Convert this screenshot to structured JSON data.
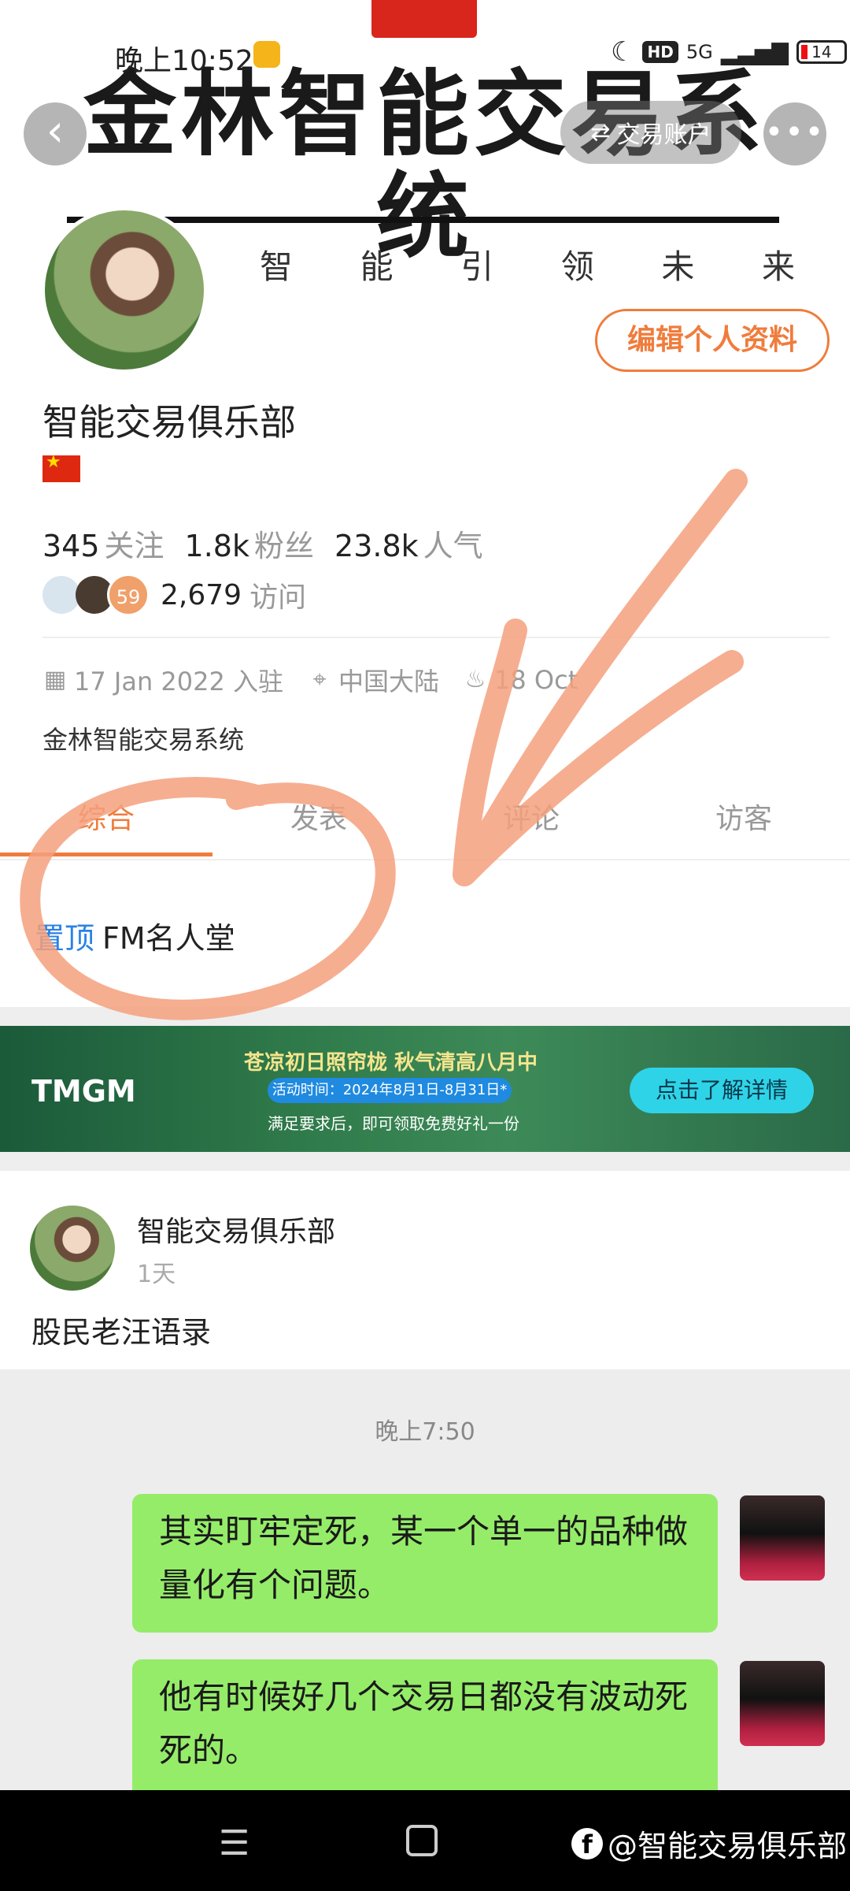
{
  "status_bar": {
    "time": "晚上10:52",
    "network": "5G",
    "hd": "HD",
    "battery": "14"
  },
  "header": {
    "banner_title": "金林智能交易系统",
    "slogan": [
      "智",
      "能",
      "引",
      "领",
      "未",
      "来"
    ]
  },
  "nav": {
    "back_icon": "chevron-left-icon",
    "account_label": "交易账户",
    "account_icon": "swap-icon",
    "more_icon": "more-dots-icon"
  },
  "profile": {
    "edit_label": "编辑个人资料",
    "name": "智能交易俱乐部",
    "flag": "china-flag",
    "stats": {
      "following_count": "345",
      "following_label": "关注",
      "fans_count": "1.8k",
      "fans_label": "粉丝",
      "popularity_count": "23.8k",
      "popularity_label": "人气"
    },
    "visitor_badge": "59",
    "visits_count": "2,679",
    "visits_label": "访问",
    "joined": "17 Jan 2022 入驻",
    "location": "中国大陆",
    "birthday": "18 Oct",
    "bio": "金林智能交易系统"
  },
  "tabs": [
    "综合",
    "发表",
    "评论",
    "访客"
  ],
  "active_tab": "综合",
  "pinned": {
    "tag": "置顶",
    "text": "FM名人堂"
  },
  "ad": {
    "brand": "TMGM",
    "headline": "苍凉初日照帘栊  秋气清高八月中",
    "date": "活动时间：2024年8月1日-8月31日*",
    "sub": "满足要求后，即可领取免费好礼一份",
    "cta": "点击了解详情"
  },
  "post": {
    "author": "智能交易俱乐部",
    "time": "1天",
    "text": "股民老汪语录",
    "chat_time": "晚上7:50",
    "messages": [
      "其实盯牢定死，某一个单一的品种做量化有个问题。",
      "他有时候好几个交易日都没有波动死死的。"
    ]
  },
  "navbar": {
    "watermark": "@智能交易俱乐部"
  },
  "colors": {
    "accent": "#f07c3c",
    "link": "#2a82e4",
    "bubble": "#95ec69",
    "annotation": "#f4a07c"
  }
}
